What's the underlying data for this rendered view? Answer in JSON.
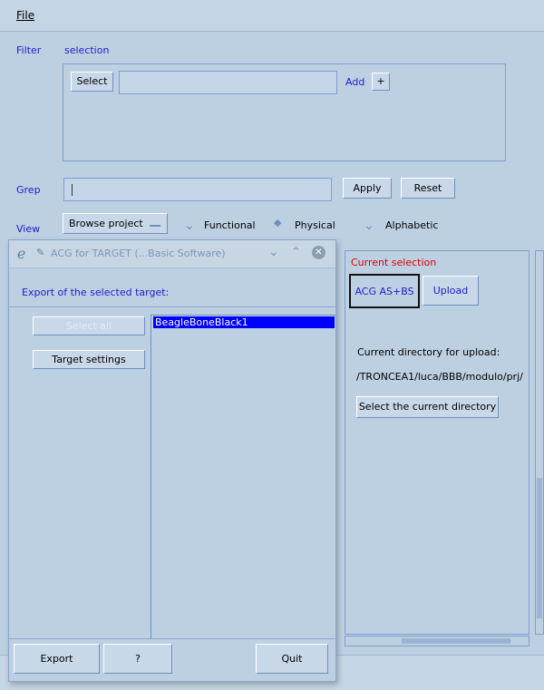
{
  "menu": {
    "file": "File"
  },
  "filter": {
    "label": "Filter",
    "tab": "selection",
    "select_btn": "Select",
    "add_label": "Add",
    "add_btn": "+"
  },
  "grep": {
    "label": "Grep",
    "value": "",
    "apply": "Apply",
    "reset": "Reset"
  },
  "view": {
    "label": "View",
    "mode": "Browse project",
    "options": [
      "Functional",
      "Physical",
      "Alphabetic"
    ],
    "selected": "Physical"
  },
  "right_panel": {
    "current_selection": "Current selection",
    "acg_btn": "ACG AS+BS",
    "upload_btn": "Upload",
    "dir_label": "Current directory for upload:",
    "dir_path": "/TRONCEA1/luca/BBB/modulo/prj/",
    "select_dir_btn": "Select the current directory"
  },
  "dialog": {
    "title": "ACG for TARGET (...Basic Software)",
    "header": "Export of the selected target:",
    "select_all": "Select all",
    "target_settings": "Target settings",
    "targets": [
      "BeagleBoneBlack1"
    ],
    "export": "Export",
    "help": "?",
    "quit": "Quit"
  },
  "colors": {
    "accent_blue": "#1c1cd0",
    "selection": "#0000ff",
    "red_label": "#e00000",
    "background": "#bdd0e2"
  }
}
